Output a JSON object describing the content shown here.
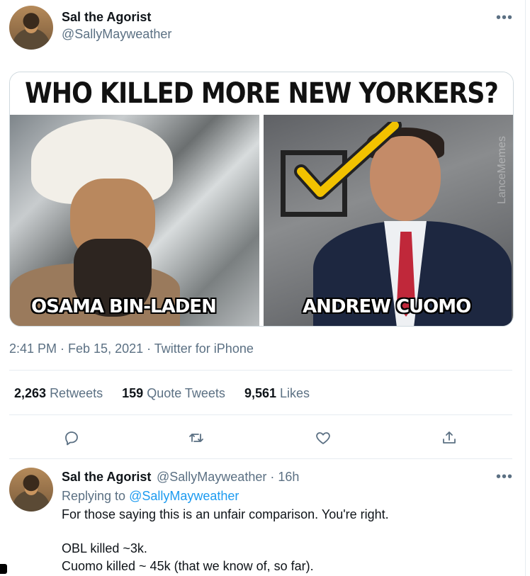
{
  "tweet": {
    "author_name": "Sal the Agorist",
    "author_handle": "@SallyMayweather",
    "more_label": "•••",
    "image": {
      "title": "WHO KILLED MORE NEW YORKERS?",
      "left_caption": "OSAMA BIN-LADEN",
      "right_caption": "ANDREW CUOMO",
      "watermark": "LanceMemes"
    },
    "timestamp": "2:41 PM · Feb 15, 2021 · Twitter for iPhone",
    "stats": {
      "retweets_count": "2,263",
      "retweets_label": "Retweets",
      "quotes_count": "159",
      "quotes_label": "Quote Tweets",
      "likes_count": "9,561",
      "likes_label": "Likes"
    },
    "actions": [
      "reply-icon",
      "retweet-icon",
      "like-icon",
      "share-icon"
    ]
  },
  "reply": {
    "author_name": "Sal the Agorist",
    "author_meta": "@SallyMayweather · 16h",
    "more_label": "•••",
    "replying_prefix": "Replying to",
    "replying_to": "@SallyMayweather",
    "line1": "For those saying this is an unfair comparison. You're right.",
    "line2": "OBL killed ~3k.",
    "line3": "Cuomo killed ~ 45k (that we know of, so far)."
  },
  "colors": {
    "text": "#0f1419",
    "secondary": "#5b7083",
    "link": "#1d9bf0",
    "border": "#e6ecf0"
  }
}
